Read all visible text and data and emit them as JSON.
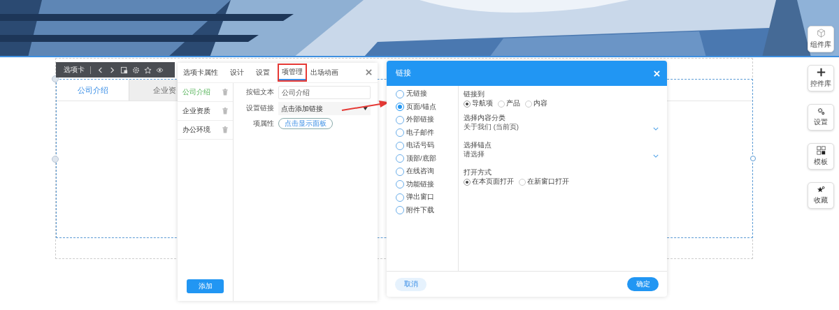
{
  "toolbar": {
    "title": "选项卡"
  },
  "tab_widget": {
    "tabs": [
      {
        "label": "公司介绍",
        "selected": true
      },
      {
        "label": "企业资",
        "selected": false
      }
    ]
  },
  "properties_panel": {
    "tabs": [
      {
        "label": "选项卡属性",
        "selected": false
      },
      {
        "label": "设计",
        "selected": false
      },
      {
        "label": "设置",
        "selected": false
      },
      {
        "label": "项管理",
        "selected": true
      },
      {
        "label": "出场动画",
        "selected": false
      }
    ],
    "items": [
      {
        "label": "公司介绍",
        "selected": true
      },
      {
        "label": "企业资质",
        "selected": false
      },
      {
        "label": "办公环境",
        "selected": false
      }
    ],
    "add_button": "添加",
    "form": {
      "button_text_label": "按钮文本",
      "button_text_value": "公司介绍",
      "link_label": "设置链接",
      "link_value": "点击添加链接",
      "item_props_label": "项属性",
      "item_props_button": "点击显示面板"
    }
  },
  "link_dialog": {
    "title": "链接",
    "link_types": [
      {
        "label": "无链接",
        "selected": false
      },
      {
        "label": "页面/锚点",
        "selected": true
      },
      {
        "label": "外部链接",
        "selected": false
      },
      {
        "label": "电子邮件",
        "selected": false
      },
      {
        "label": "电话号码",
        "selected": false
      },
      {
        "label": "顶部/底部",
        "selected": false
      },
      {
        "label": "在线咨询",
        "selected": false
      },
      {
        "label": "功能链接",
        "selected": false
      },
      {
        "label": "弹出窗口",
        "selected": false
      },
      {
        "label": "附件下载",
        "selected": false
      }
    ],
    "link_to": {
      "label": "链接到",
      "options": [
        {
          "label": "导航项",
          "selected": true
        },
        {
          "label": "产品",
          "selected": false
        },
        {
          "label": "内容",
          "selected": false
        }
      ]
    },
    "category": {
      "label": "选择内容分类",
      "value": "关于我们 (当前页)"
    },
    "anchor": {
      "label": "选择锚点",
      "value": "请选择"
    },
    "open_mode": {
      "label": "打开方式",
      "options": [
        {
          "label": "在本页面打开",
          "selected": true
        },
        {
          "label": "在新窗口打开",
          "selected": false
        }
      ]
    },
    "cancel": "取消",
    "confirm": "确定"
  },
  "side_tools": [
    {
      "label": "组件库",
      "kind": "cube"
    },
    {
      "label": "控件库",
      "kind": "plus"
    },
    {
      "label": "设置",
      "kind": "gears"
    },
    {
      "label": "模板",
      "kind": "grid"
    },
    {
      "label": "收藏",
      "kind": "star"
    }
  ]
}
